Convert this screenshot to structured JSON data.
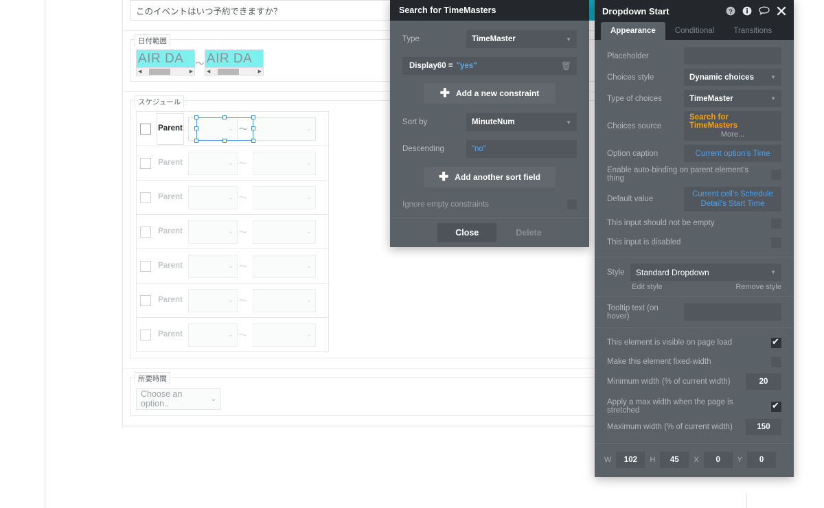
{
  "app_preview": {
    "question_input": {
      "value": "このイベントはいつ予約できますか？"
    },
    "date_range": {
      "legend": "日付範囲",
      "start_value": "AIR DA",
      "end_value": "AIR DA",
      "separator": "～"
    },
    "schedule": {
      "legend": "スケジュール",
      "rows": [
        {
          "parent_label": "Parent",
          "start": "",
          "sep": "～",
          "end": ""
        },
        {
          "parent_label": "Parent",
          "start": "",
          "sep": "～",
          "end": ""
        },
        {
          "parent_label": "Parent",
          "start": "",
          "sep": "～",
          "end": ""
        },
        {
          "parent_label": "Parent",
          "start": "",
          "sep": "～",
          "end": ""
        },
        {
          "parent_label": "Parent",
          "start": "",
          "sep": "～",
          "end": ""
        },
        {
          "parent_label": "Parent",
          "start": "",
          "sep": "～",
          "end": ""
        },
        {
          "parent_label": "Parent",
          "start": "",
          "sep": "～",
          "end": ""
        }
      ]
    },
    "duration": {
      "legend": "所要時間",
      "placeholder": "Choose an option..",
      "value": "Choose an option.."
    }
  },
  "search_dialog": {
    "title": "Search for TimeMasters",
    "type_label": "Type",
    "type_value": "TimeMaster",
    "constraint": {
      "field": "Display60 =",
      "value": "\"yes\"",
      "delete_icon": "trash-icon"
    },
    "add_constraint_label": "Add a new constraint",
    "sort_by_label": "Sort by",
    "sort_by_value": "MinuteNum",
    "descending_label": "Descending",
    "descending_value": "\"no\"",
    "add_sort_label": "Add another sort field",
    "ignore_empty_label": "Ignore empty constraints",
    "ignore_empty_checked": false,
    "close_label": "Close",
    "delete_label": "Delete"
  },
  "property_editor": {
    "title": "Dropdown Start",
    "header_icons": [
      "help-icon",
      "info-icon",
      "comment-icon",
      "close-icon"
    ],
    "tabs": [
      {
        "label": "Appearance",
        "active": true
      },
      {
        "label": "Conditional",
        "active": false
      },
      {
        "label": "Transitions",
        "active": false
      }
    ],
    "fields": {
      "placeholder_label": "Placeholder",
      "placeholder_value": "",
      "choices_style_label": "Choices style",
      "choices_style_value": "Dynamic choices",
      "type_of_choices_label": "Type of choices",
      "type_of_choices_value": "TimeMaster",
      "choices_source_label": "Choices source",
      "choices_source_value": "Search for TimeMasters",
      "choices_source_more": "More...",
      "option_caption_label": "Option caption",
      "option_caption_value": "Current option's Time",
      "autobind_label": "Enable auto-binding on parent element's thing",
      "autobind_checked": false,
      "default_value_label": "Default value",
      "default_value_line1": "Current cell's Schedule",
      "default_value_line2": "Detail's Start Time",
      "not_empty_label": "This input should not be empty",
      "not_empty_checked": false,
      "disabled_label": "This input is disabled",
      "disabled_checked": false,
      "style_label": "Style",
      "style_value": "Standard Dropdown",
      "edit_style_link": "Edit style",
      "remove_style_link": "Remove style",
      "tooltip_label": "Tooltip text (on hover)",
      "tooltip_value": "",
      "visible_label": "This element is visible on page load",
      "visible_checked": true,
      "fixed_width_label": "Make this element fixed-width",
      "fixed_width_checked": false,
      "min_width_label": "Minimum width (% of current width)",
      "min_width_value": "20",
      "max_width_apply_label": "Apply a max width when the page is stretched",
      "max_width_apply_checked": true,
      "max_width_label": "Maximum width (% of current width)",
      "max_width_value": "150"
    },
    "geometry": {
      "w_label": "W",
      "w_value": "102",
      "h_label": "H",
      "h_value": "45",
      "x_label": "X",
      "x_value": "0",
      "y_label": "Y",
      "y_value": "0"
    }
  },
  "colors": {
    "panel_bg": "#5a6167",
    "panel_title_bg": "#24282c",
    "field_bg": "#51575d",
    "accent_orange": "#f0a122",
    "accent_blue": "#4f9fe8",
    "selection_blue": "#3d92ea",
    "highlight_cyan": "#7ef1ef",
    "teal_bar": "#10a9bf"
  }
}
